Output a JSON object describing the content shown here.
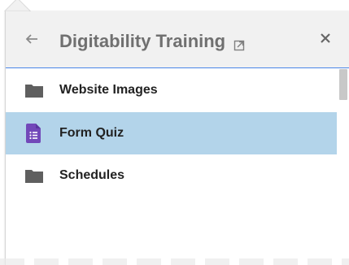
{
  "header": {
    "back_icon": "arrow-left-icon",
    "title": "Digitability Training",
    "open_icon": "open-in-new-icon",
    "close_icon": "close-icon"
  },
  "items": [
    {
      "label": "Website Images",
      "icon": "folder-icon",
      "selected": false
    },
    {
      "label": "Form Quiz",
      "icon": "google-forms-icon",
      "selected": true
    },
    {
      "label": "Schedules",
      "icon": "folder-icon",
      "selected": false
    }
  ],
  "colors": {
    "selected_row": "#b3d4ea",
    "header_bg": "#f1f1f1",
    "header_border": "#4a86e8",
    "folder": "#5f5f5f",
    "forms_icon": "#7248b9"
  }
}
